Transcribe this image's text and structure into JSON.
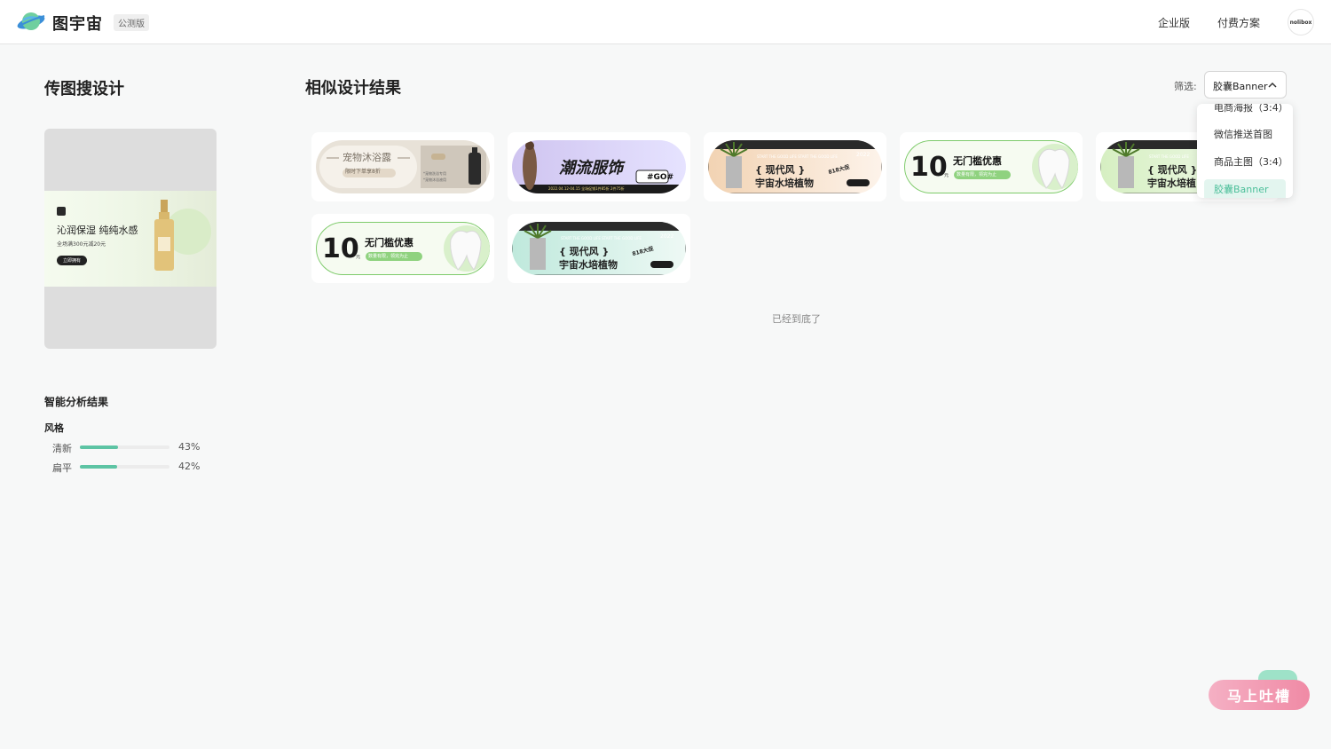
{
  "header": {
    "brand": "图宇宙",
    "beta_badge": "公测版",
    "nav": {
      "enterprise": "企业版",
      "pricing": "付费方案"
    },
    "avatar_text": "nolibox"
  },
  "left": {
    "title": "传图搜设计",
    "uploaded": {
      "title": "沁润保湿 纯纯水感",
      "subtitle": "全场满300元减20元",
      "button": "立即拥有"
    },
    "analysis_title": "智能分析结果",
    "style_label": "风格",
    "styles": [
      {
        "label": "清新",
        "percent": "43%",
        "value": 0.43
      },
      {
        "label": "扁平",
        "percent": "42%",
        "value": 0.42
      }
    ]
  },
  "main": {
    "title": "相似设计结果",
    "filter": {
      "label": "筛选:",
      "value": "胶囊Banner"
    },
    "end_text": "已经到底了",
    "cards": [
      {
        "title": "宠物沐浴露",
        "subtitle": "限时下单享8折",
        "sub2": "*宠物洗浴专用",
        "sub3": "*宠物沐浴液用"
      },
      {
        "title": "潮流服饰",
        "tag": "#GO#",
        "sub": "2022.04.12-04.15  全场促销1件85折 2件75折"
      },
      {
        "tagline": "START THE GOOD LIFE  START THE GOOD LIFE",
        "year": "2022",
        "title": "{ 现代风 }",
        "sub": "宇宙水培植物",
        "badge": "818大促"
      },
      {
        "num": "10",
        "unit": "元",
        "title": "无门槛优惠",
        "sub": "数量有限，领完为止"
      },
      {
        "tagline": "START THE GOOD LIFE",
        "title": "{ 现代风 }",
        "sub": "宇宙水培植"
      },
      {
        "num": "10",
        "unit": "元",
        "title": "无门槛优惠",
        "sub": "数量有限，领完为止"
      },
      {
        "tagline": "START THE GOOD LIFE  START THE GOOD LIFE",
        "year": "2022",
        "title": "{ 现代风 }",
        "sub": "宇宙水培植物",
        "badge": "818大促"
      }
    ]
  },
  "dropdown": {
    "items": [
      "电商海报（3:4）",
      "微信推送首图",
      "商品主图（3:4）",
      "胶囊Banner"
    ],
    "selected": "胶囊Banner"
  },
  "feedback": {
    "label": "马上吐槽"
  },
  "colors": {
    "accent": "#5dc4a4",
    "feedback": "#f08aa5"
  }
}
